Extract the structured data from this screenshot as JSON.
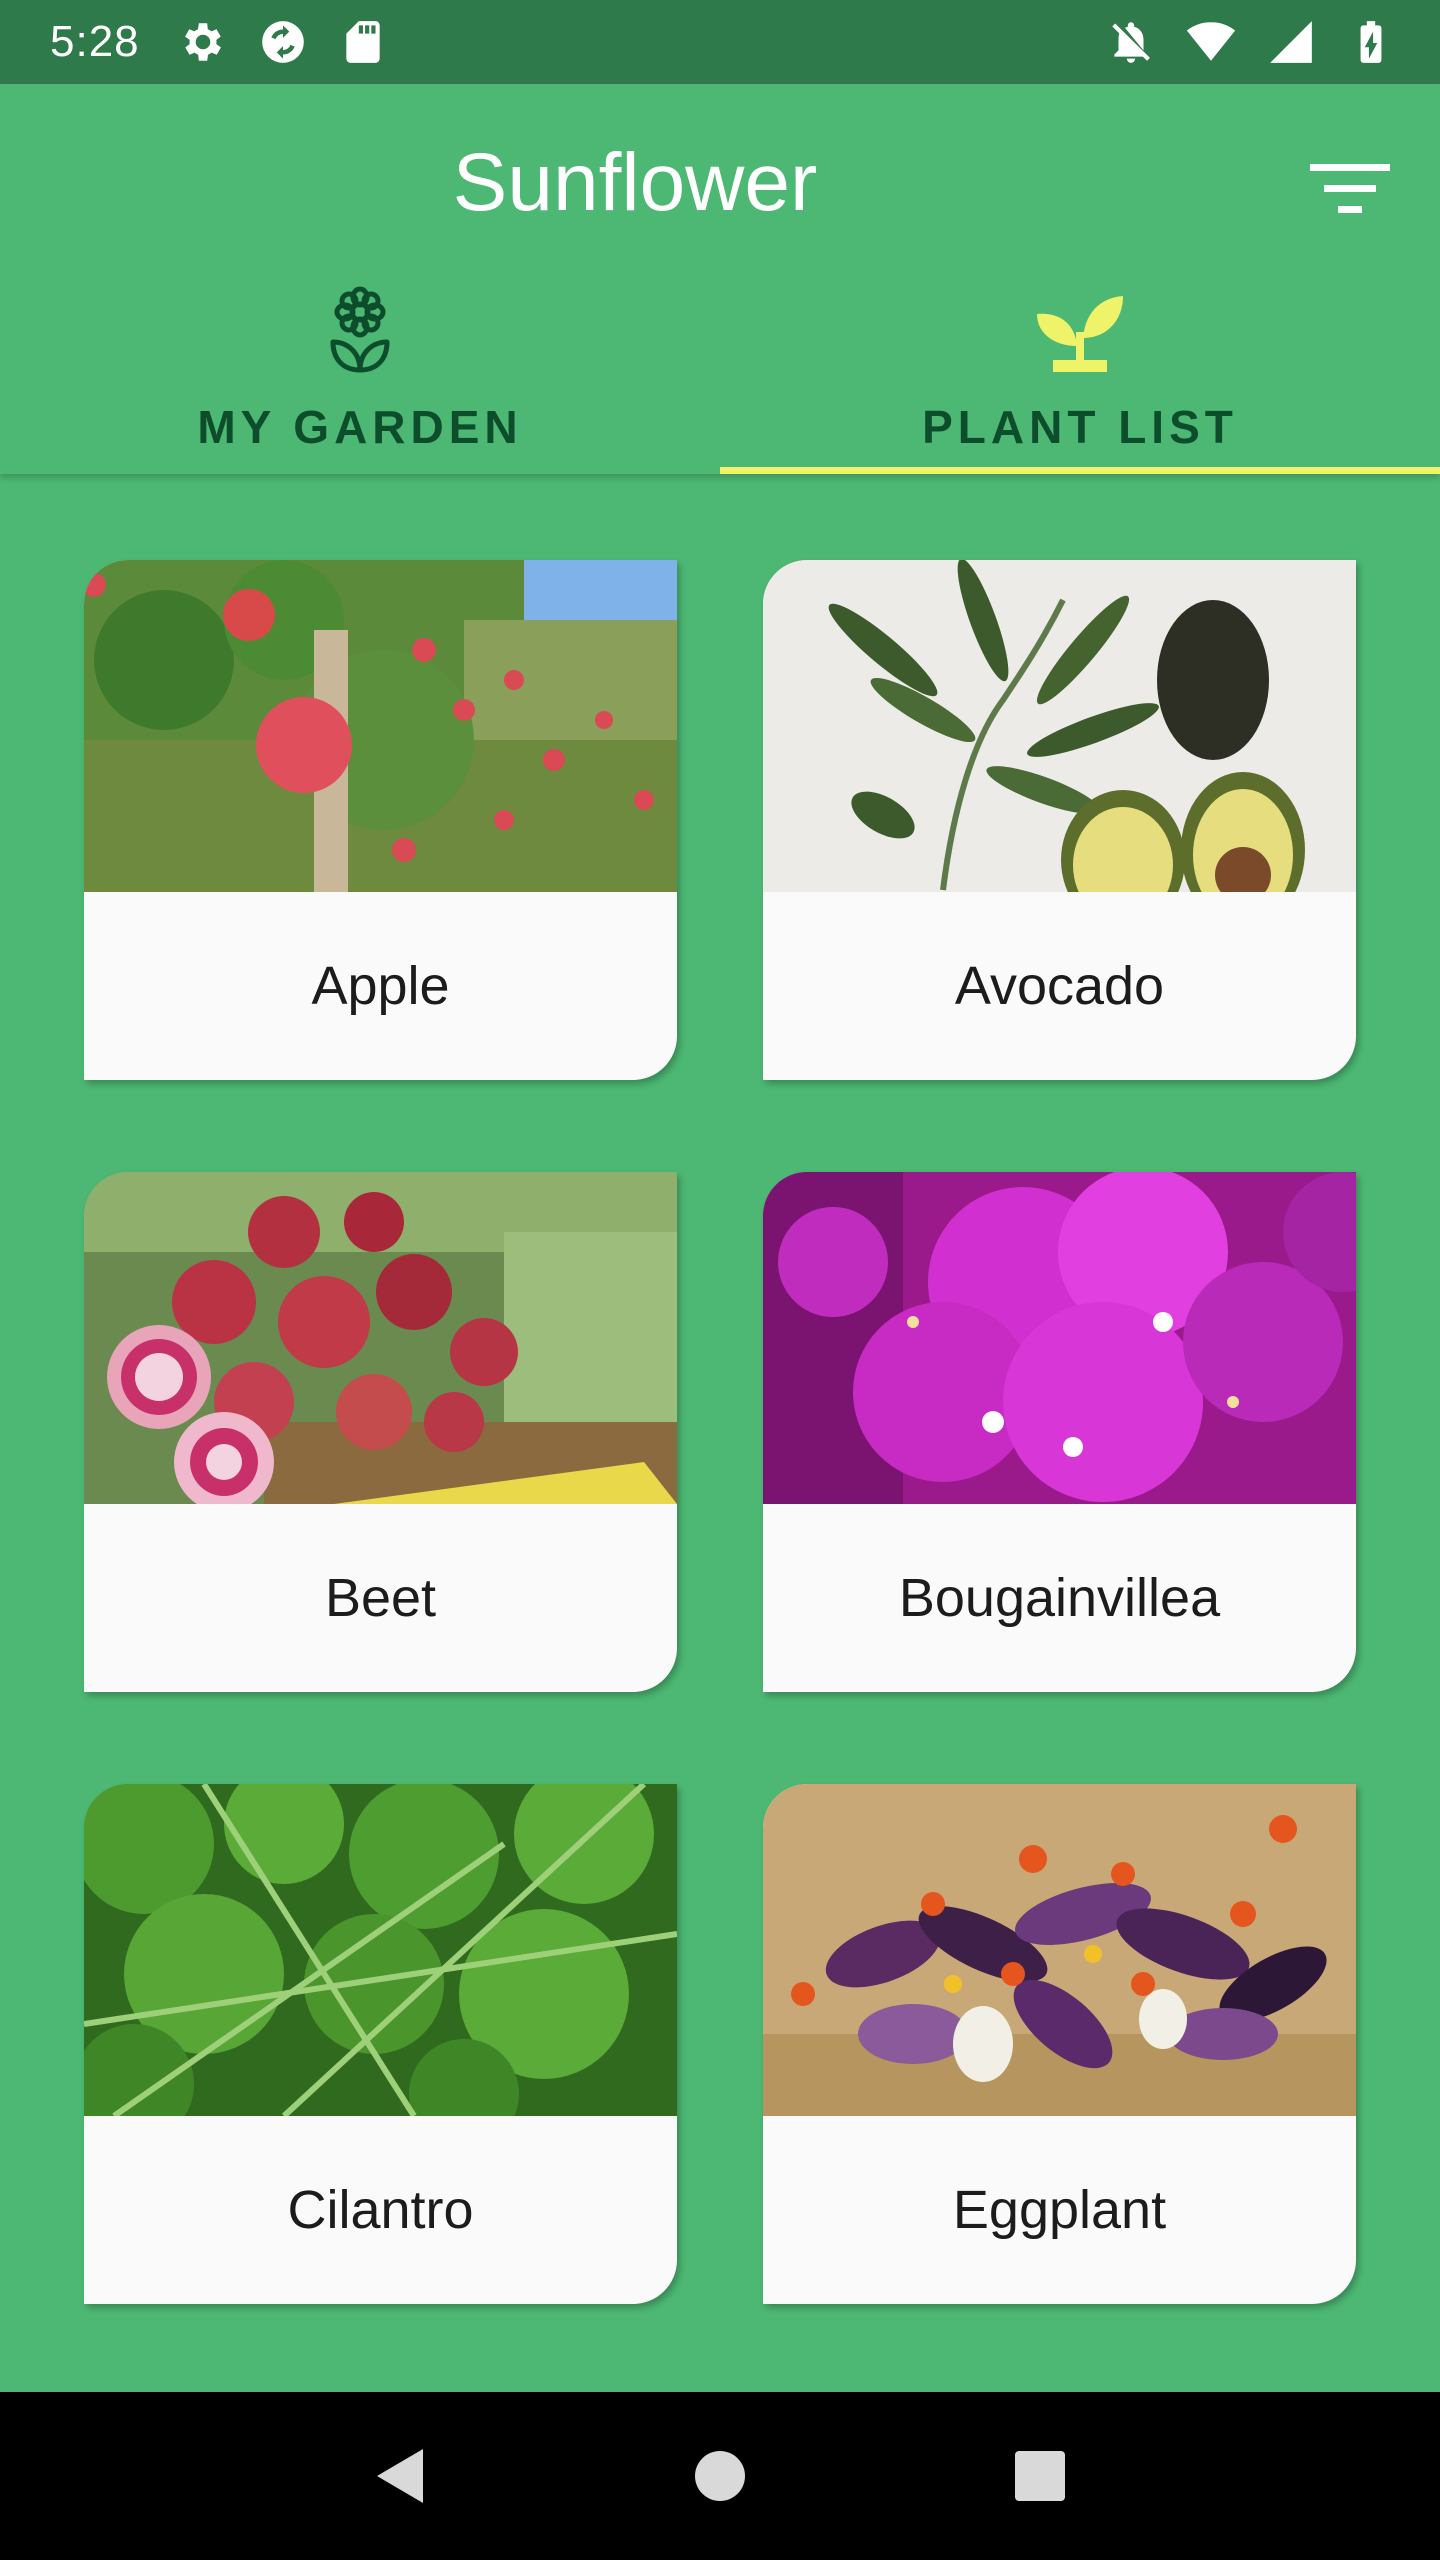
{
  "status_bar": {
    "time": "5:28",
    "left_icons": [
      "settings-icon",
      "sync-icon",
      "sd-card-icon"
    ],
    "right_icons": [
      "notifications-off-icon",
      "wifi-icon",
      "signal-icon",
      "battery-charging-icon"
    ]
  },
  "app_bar": {
    "title": "Sunflower",
    "filter_icon": "filter-list-icon"
  },
  "tabs": [
    {
      "label": "MY GARDEN",
      "icon": "flower-icon",
      "selected": false
    },
    {
      "label": "PLANT LIST",
      "icon": "sprout-icon",
      "selected": true
    }
  ],
  "colors": {
    "primary": "#4cb873",
    "status_bar": "#2f7a4a",
    "tab_text": "#0e4d2b",
    "tab_indicator": "#eef36a",
    "selected_tab_icon": "#eef36a",
    "card_background": "#fafafa"
  },
  "plants": [
    {
      "name": "Apple"
    },
    {
      "name": "Avocado"
    },
    {
      "name": "Beet"
    },
    {
      "name": "Bougainvillea"
    },
    {
      "name": "Cilantro"
    },
    {
      "name": "Eggplant"
    }
  ],
  "nav_bar": {
    "icons": [
      "back-icon",
      "home-icon",
      "recents-icon"
    ]
  }
}
